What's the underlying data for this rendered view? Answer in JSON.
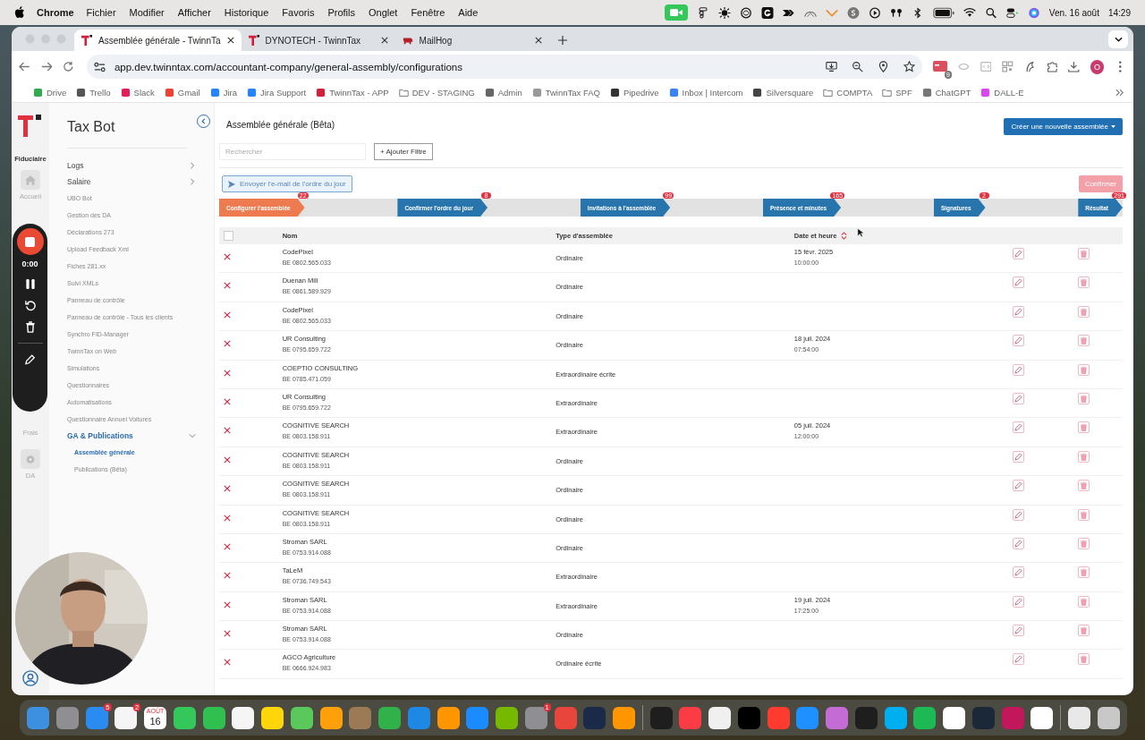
{
  "menubar": {
    "app": "Chrome",
    "menus": [
      "Fichier",
      "Modifier",
      "Afficher",
      "Historique",
      "Favoris",
      "Profils",
      "Onglet",
      "Fenêtre",
      "Aide"
    ],
    "date": "Ven. 16 août",
    "time": "14:29"
  },
  "tabs": [
    {
      "title": "Assemblée générale - TwinnTa",
      "selected": true
    },
    {
      "title": "DYNOTECH - TwinnTax",
      "selected": false
    },
    {
      "title": "MailHog",
      "selected": false
    }
  ],
  "address": "app.dev.twinntax.com/accountant-company/general-assembly/configurations",
  "extension_badge": "9",
  "profile_letter": "O",
  "bookmarks": [
    {
      "label": "Drive",
      "kind": "logo",
      "color": "#34a853"
    },
    {
      "label": "Trello",
      "kind": "logo",
      "color": "#555555"
    },
    {
      "label": "Slack",
      "kind": "logo",
      "color": "#e01e5a"
    },
    {
      "label": "Gmail",
      "kind": "logo",
      "color": "#ea4335"
    },
    {
      "label": "Jira",
      "kind": "logo",
      "color": "#2684ff"
    },
    {
      "label": "Jira Support",
      "kind": "logo",
      "color": "#2684ff"
    },
    {
      "label": "TwinnTax - APP",
      "kind": "logo",
      "color": "#d3203a"
    },
    {
      "label": "DEV - STAGING",
      "kind": "folder"
    },
    {
      "label": "Admin",
      "kind": "logo",
      "color": "#666666"
    },
    {
      "label": "TwinnTax FAQ",
      "kind": "logo",
      "color": "#999999"
    },
    {
      "label": "Pipedrive",
      "kind": "logo",
      "color": "#333333"
    },
    {
      "label": "Inbox | Intercom",
      "kind": "logo",
      "color": "#3b82f6"
    },
    {
      "label": "Silversquare",
      "kind": "logo",
      "color": "#444444"
    },
    {
      "label": "COMPTA",
      "kind": "folder"
    },
    {
      "label": "SPF",
      "kind": "folder"
    },
    {
      "label": "ChatGPT",
      "kind": "logo",
      "color": "#777777"
    },
    {
      "label": "DALL-E",
      "kind": "logo",
      "color": "#d946ef"
    }
  ],
  "rail": {
    "section": "Fiduciaire",
    "items": [
      {
        "label": "Accueil",
        "icon": true
      },
      {
        "label": "Frais",
        "icon": false
      },
      {
        "label": "DA",
        "icon": true
      }
    ]
  },
  "sidebar": {
    "title": "Tax Bot",
    "items": [
      {
        "label": "Logs",
        "kind": "group",
        "expanded": false
      },
      {
        "label": "Salaire",
        "kind": "group",
        "expanded": false
      },
      {
        "label": "UBO Bot",
        "kind": "link"
      },
      {
        "label": "Gestion des DA",
        "kind": "link"
      },
      {
        "label": "Déclarations 273",
        "kind": "link"
      },
      {
        "label": "Upload Feedback Xml",
        "kind": "link"
      },
      {
        "label": "Fiches 281.xx",
        "kind": "link"
      },
      {
        "label": "Suivi XMLs",
        "kind": "link"
      },
      {
        "label": "Panneau de contrôle",
        "kind": "link"
      },
      {
        "label": "Panneau de contrôle - Tous les clients",
        "kind": "link"
      },
      {
        "label": "Synchro FID-Manager",
        "kind": "link"
      },
      {
        "label": "TwinnTax on Web",
        "kind": "link"
      },
      {
        "label": "Simulations",
        "kind": "link"
      },
      {
        "label": "Questionnaires",
        "kind": "link"
      },
      {
        "label": "Automatisations",
        "kind": "link"
      },
      {
        "label": "Questionnaire Annuel Voitures",
        "kind": "link"
      },
      {
        "label": "GA & Publications",
        "kind": "group",
        "expanded": true,
        "children": [
          {
            "label": "Assemblée générale",
            "selected": true
          },
          {
            "label": "Publications (Bêta)",
            "selected": false
          }
        ]
      }
    ]
  },
  "page": {
    "title": "Assemblée générale (Bêta)",
    "create_button": "Créer une nouvelle assemblée",
    "search": {
      "placeholder": "Rechercher"
    },
    "filter_button": "+ Ajouter Filtre",
    "email_button": "Envoyer l'e-mail de l'ordre du jour",
    "confirm_button": {
      "label": "Confirmer",
      "disabled": true
    }
  },
  "steps": [
    {
      "label": "Configurer l'assemblée",
      "count": "22",
      "selected": true
    },
    {
      "label": "Confirmer l'ordre du jour",
      "count": "8",
      "selected": false
    },
    {
      "label": "Invitations à l'assemblée",
      "count": "99",
      "selected": false
    },
    {
      "label": "Présence et minutes",
      "count": "165",
      "selected": false
    },
    {
      "label": "Signatures",
      "count": "2",
      "selected": false
    },
    {
      "label": "Résultat",
      "count": "291",
      "selected": false
    }
  ],
  "table": {
    "select_all": {
      "checked": false
    },
    "columns": [
      "Nom",
      "Type d'assemblée",
      "Date et heure"
    ],
    "rows": [
      {
        "name": "CodePixel",
        "vat": "BE 0802.565.033",
        "type": "Ordinaire",
        "date": "15 févr. 2025",
        "time": "10:00:00"
      },
      {
        "name": "Duenan Mill",
        "vat": "BE 0861.589.929",
        "type": "Ordinaire"
      },
      {
        "name": "CodePixel",
        "vat": "BE 0802.565.033",
        "type": "Ordinaire"
      },
      {
        "name": "UR Consulting",
        "vat": "BE 0795.659.722",
        "type": "Ordinaire",
        "date": "18 juil. 2024",
        "time": "07:54:00"
      },
      {
        "name": "COEPTIO CONSULTING",
        "vat": "BE 0785.471.059",
        "type": "Extraordinaire écrite"
      },
      {
        "name": "UR Consulting",
        "vat": "BE 0795.659.722",
        "type": "Extraordinaire"
      },
      {
        "name": "COGNITIVE SEARCH",
        "vat": "BE 0803.158.911",
        "type": "Extraordinaire",
        "date": "05 juil. 2024",
        "time": "12:00:00"
      },
      {
        "name": "COGNITIVE SEARCH",
        "vat": "BE 0803.158.911",
        "type": "Ordinaire"
      },
      {
        "name": "COGNITIVE SEARCH",
        "vat": "BE 0803.158.911",
        "type": "Ordinaire"
      },
      {
        "name": "COGNITIVE SEARCH",
        "vat": "BE 0803.158.911",
        "type": "Ordinaire"
      },
      {
        "name": "Stroman SARL",
        "vat": "BE 0753.914.088",
        "type": "Ordinaire"
      },
      {
        "name": "TaLeM",
        "vat": "BE 0736.749.543",
        "type": "Extraordinaire"
      },
      {
        "name": "Stroman SARL",
        "vat": "BE 0753.914.088",
        "type": "Extraordinaire",
        "date": "19 juil. 2024",
        "time": "17:25:00"
      },
      {
        "name": "Stroman SARL",
        "vat": "BE 0753.914.088",
        "type": "Ordinaire"
      },
      {
        "name": "AGCO Agriculture",
        "vat": "BE 0666.924.983",
        "type": "Ordinaire écrite"
      }
    ]
  },
  "recorder": {
    "time": "0:00"
  },
  "dock": [
    {
      "kind": "app",
      "color": "#3d8fe0"
    },
    {
      "kind": "app",
      "color": "#8e8e93"
    },
    {
      "kind": "app",
      "color": "#2a8cf0",
      "badge": "5"
    },
    {
      "kind": "app",
      "color": "#f5f5f5",
      "badge": "2"
    },
    {
      "kind": "calendar",
      "month": "AOÛT",
      "day": "16"
    },
    {
      "kind": "app",
      "color": "#34c759"
    },
    {
      "kind": "app",
      "color": "#30c050"
    },
    {
      "kind": "app",
      "color": "#f5f5f5"
    },
    {
      "kind": "app",
      "color": "#ffd60a"
    },
    {
      "kind": "app",
      "color": "#5ac85a"
    },
    {
      "kind": "app",
      "color": "#ff9f0a"
    },
    {
      "kind": "app",
      "color": "#9a7b55"
    },
    {
      "kind": "app",
      "color": "#30b14a"
    },
    {
      "kind": "app",
      "color": "#1e88e5"
    },
    {
      "kind": "app",
      "color": "#ff9500"
    },
    {
      "kind": "app",
      "color": "#1a8cff"
    },
    {
      "kind": "app",
      "color": "#76b900"
    },
    {
      "kind": "app",
      "color": "#8e8e93",
      "badge": "1"
    },
    {
      "kind": "app",
      "color": "#e8453c"
    },
    {
      "kind": "app",
      "color": "#1c2a4a"
    },
    {
      "kind": "app",
      "color": "#ff9500"
    },
    {
      "kind": "separator"
    },
    {
      "kind": "app",
      "color": "#1e1e1e"
    },
    {
      "kind": "app",
      "color": "#fc3c44"
    },
    {
      "kind": "app",
      "color": "#f0f0f0"
    },
    {
      "kind": "app",
      "color": "#000000"
    },
    {
      "kind": "app",
      "color": "#ff3b30"
    },
    {
      "kind": "app",
      "color": "#1e90ff"
    },
    {
      "kind": "app",
      "color": "#c46bd6"
    },
    {
      "kind": "app",
      "color": "#1e1e1e"
    },
    {
      "kind": "app",
      "color": "#00aff0"
    },
    {
      "kind": "app",
      "color": "#1db954"
    },
    {
      "kind": "app",
      "color": "#ffffff"
    },
    {
      "kind": "app",
      "color": "#1b2838"
    },
    {
      "kind": "app",
      "color": "#c2185b"
    },
    {
      "kind": "app",
      "color": "#ffffff"
    },
    {
      "kind": "separator"
    },
    {
      "kind": "app",
      "color": "#e8e8e8"
    },
    {
      "kind": "app",
      "color": "#c8c8c8"
    }
  ]
}
